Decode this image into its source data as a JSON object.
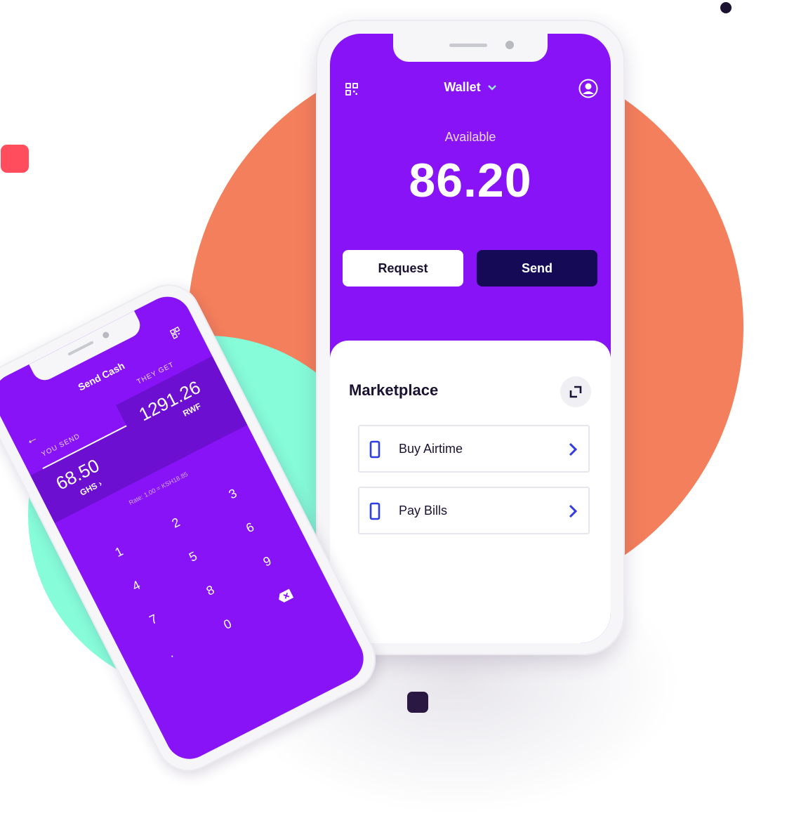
{
  "colors": {
    "orange": "#f47f5c",
    "mint": "#86fcd9",
    "purple": "#8713f6",
    "navy": "#150a55",
    "red": "#ff4d5e"
  },
  "wallet": {
    "title": "Wallet",
    "available_label": "Available",
    "balance": "86.20",
    "request_label": "Request",
    "send_label": "Send",
    "icons": [
      "qr-code-icon",
      "chevron-down-icon",
      "profile-icon"
    ]
  },
  "marketplace": {
    "title": "Marketplace",
    "expand_icon": "expand-icon",
    "items": [
      {
        "label": "Buy Airtime",
        "icon": "phone-icon"
      },
      {
        "label": "Pay Bills",
        "icon": "bill-icon"
      }
    ]
  },
  "send_cash": {
    "title": "Send Cash",
    "back_icon": "←",
    "you_send_label": "YOU SEND",
    "they_get_label": "THEY GET",
    "send_amount": "68.50",
    "send_currency": "GHS ›",
    "get_amount": "1291.26",
    "get_currency": "RWF",
    "rate": "Rate: 1.00 = KSH18.85",
    "keypad": [
      "1",
      "2",
      "3",
      "4",
      "5",
      "6",
      "7",
      "8",
      "9",
      ".",
      "0"
    ]
  }
}
